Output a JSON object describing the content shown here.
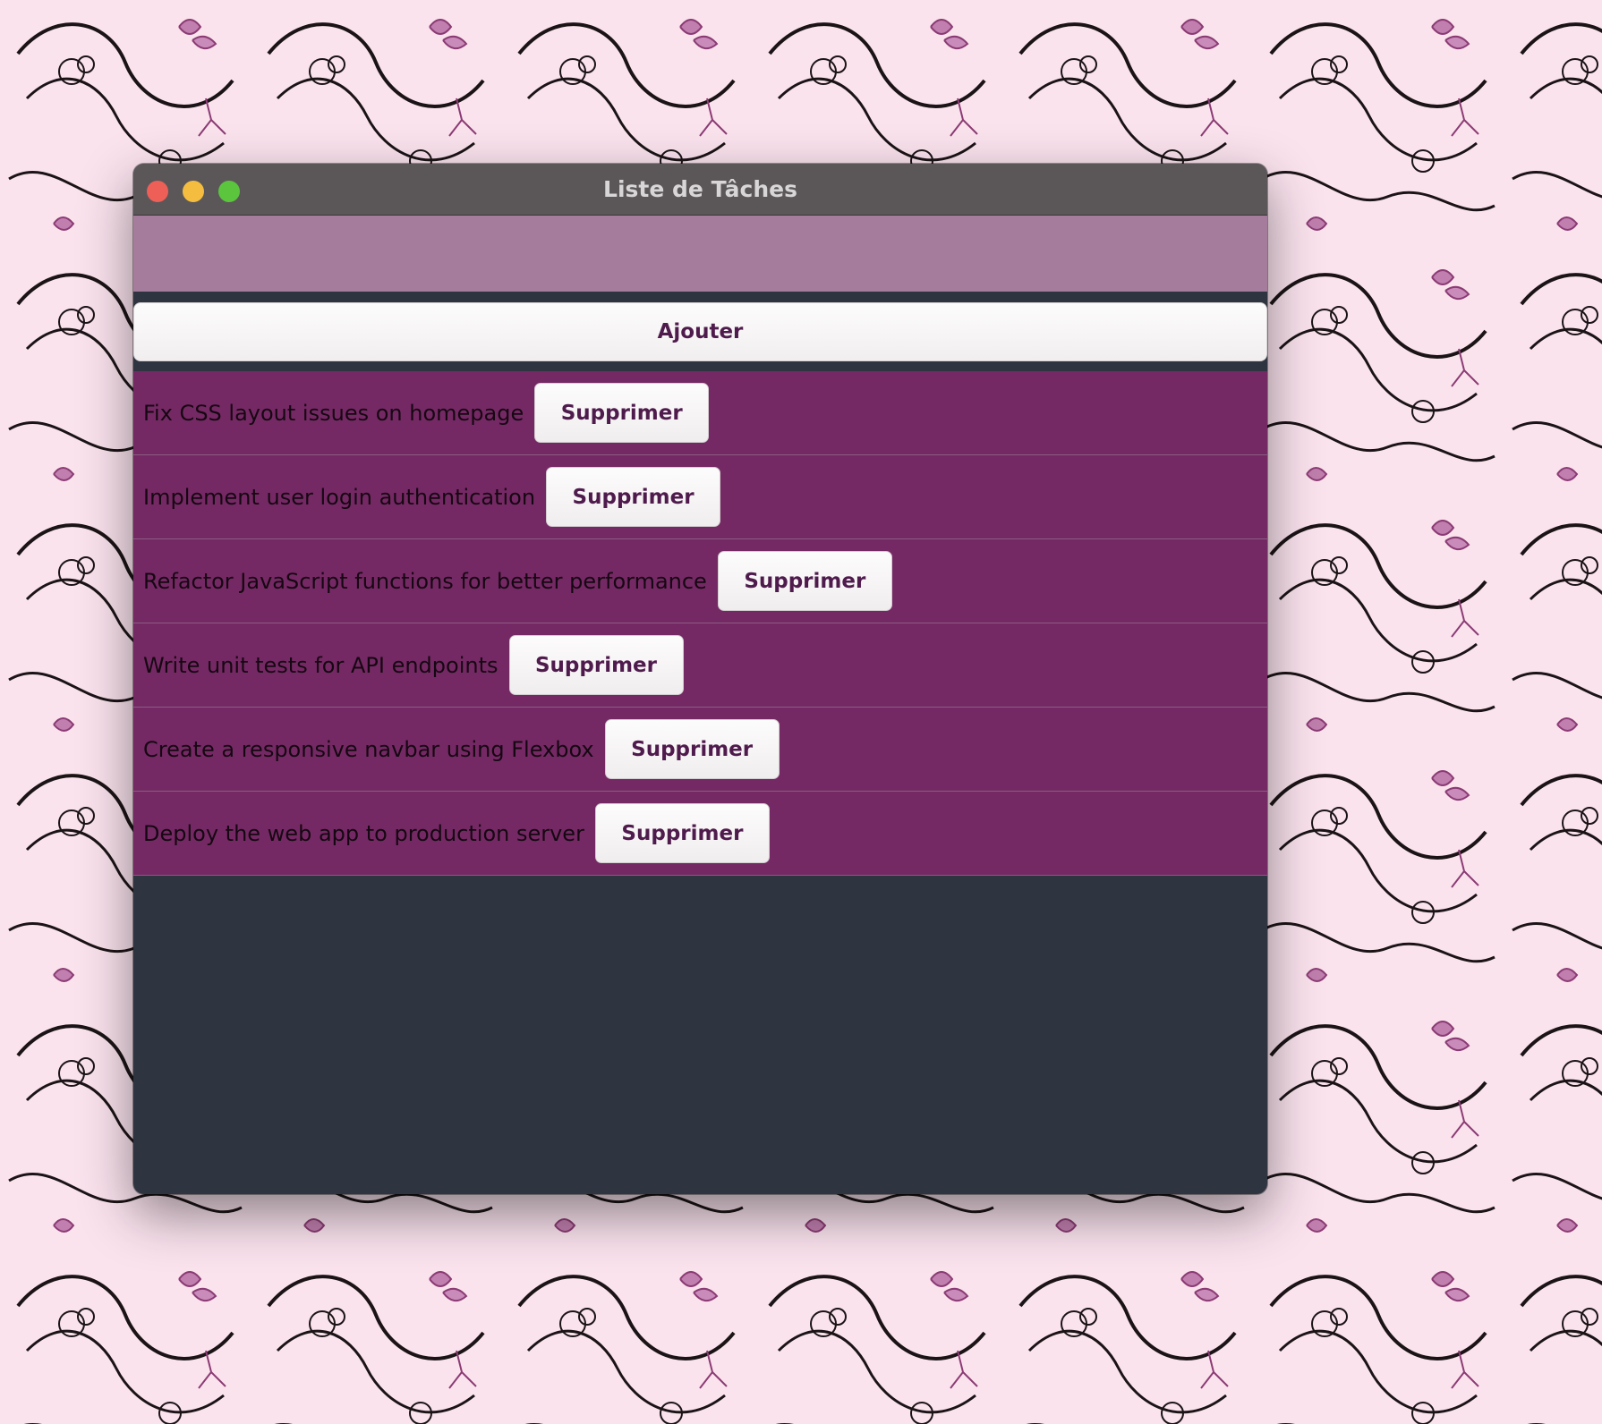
{
  "window": {
    "title": "Liste de Tâches"
  },
  "input": {
    "value": "",
    "placeholder": ""
  },
  "add_button": {
    "label": "Ajouter"
  },
  "tasks": [
    {
      "text": "Fix CSS layout issues on homepage",
      "delete_label": "Supprimer"
    },
    {
      "text": "Implement user login authentication",
      "delete_label": "Supprimer"
    },
    {
      "text": "Refactor JavaScript functions for better performance",
      "delete_label": "Supprimer"
    },
    {
      "text": "Write unit tests for API endpoints",
      "delete_label": "Supprimer"
    },
    {
      "text": "Create a responsive navbar using Flexbox",
      "delete_label": "Supprimer"
    },
    {
      "text": "Deploy the web app to production server",
      "delete_label": "Supprimer"
    }
  ],
  "colors": {
    "window_body": "#2e3440",
    "titlebar": "#5b5759",
    "input_bg": "#a57c9b",
    "task_row_bg": "#752964",
    "button_text": "#4f1b4d",
    "wallpaper_bg": "#fbe3ee"
  },
  "icons": {
    "close": "close-window-icon",
    "minimize": "minimize-window-icon",
    "maximize": "maximize-window-icon"
  }
}
